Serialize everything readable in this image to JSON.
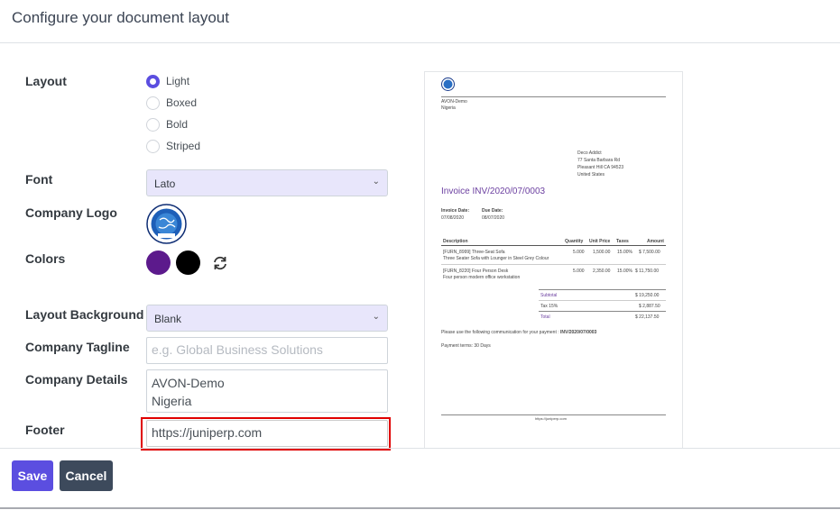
{
  "header": {
    "title": "Configure your document layout"
  },
  "labels": {
    "layout": "Layout",
    "font": "Font",
    "company_logo": "Company Logo",
    "colors": "Colors",
    "layout_background": "Layout Background",
    "company_tagline": "Company Tagline",
    "company_details": "Company Details",
    "footer": "Footer"
  },
  "layout_options": [
    {
      "label": "Light",
      "selected": true
    },
    {
      "label": "Boxed",
      "selected": false
    },
    {
      "label": "Bold",
      "selected": false
    },
    {
      "label": "Striped",
      "selected": false
    }
  ],
  "font_select": {
    "value": "Lato"
  },
  "colors": {
    "primary": "#5c1a8c",
    "secondary": "#000000"
  },
  "background_select": {
    "value": "Blank"
  },
  "tagline": {
    "value": "",
    "placeholder": "e.g. Global Business Solutions"
  },
  "company_details": {
    "line1": "AVON-Demo",
    "line2": "Nigeria"
  },
  "footer_field": {
    "value": "https://juniperp.com"
  },
  "buttons": {
    "save": "Save",
    "cancel": "Cancel"
  },
  "preview": {
    "company": "AVON-Demo",
    "country": "Nigeria",
    "address": [
      "Deco Addict",
      "77 Santa Barbara Rd",
      "Pleasant Hill CA 94523",
      "United States"
    ],
    "invoice_title": "Invoice INV/2020/07/0003",
    "invoice_date_label": "Invoice Date:",
    "invoice_date": "07/08/2020",
    "due_date_label": "Due Date:",
    "due_date": "08/07/2020",
    "table_headers": [
      "Description",
      "Quantity",
      "Unit Price",
      "Taxes",
      "Amount"
    ],
    "rows": [
      {
        "desc1": "[FURN_8999] Three-Seat Sofa",
        "desc2": "Three Seater Sofa with Lounger in Steel Grey Colour",
        "qty": "5.000",
        "price": "1,500.00",
        "tax": "15.00%",
        "amount": "$ 7,500.00"
      },
      {
        "desc1": "[FURN_8220] Four Person Desk",
        "desc2": "Four person modern office workstation",
        "qty": "5.000",
        "price": "2,350.00",
        "tax": "15.00%",
        "amount": "$ 11,750.00"
      }
    ],
    "subtotal_label": "Subtotal",
    "subtotal": "$ 19,250.00",
    "tax_label": "Tax 15%",
    "tax": "$ 2,887.50",
    "total_label": "Total",
    "total": "$ 22,137.50",
    "payment_comm_prefix": "Please use the following communication for your payment : ",
    "payment_comm_ref": "INV/2020/07/0003",
    "payment_terms": "Payment terms: 30 Days",
    "footer_url": "https://juniperp.com"
  }
}
